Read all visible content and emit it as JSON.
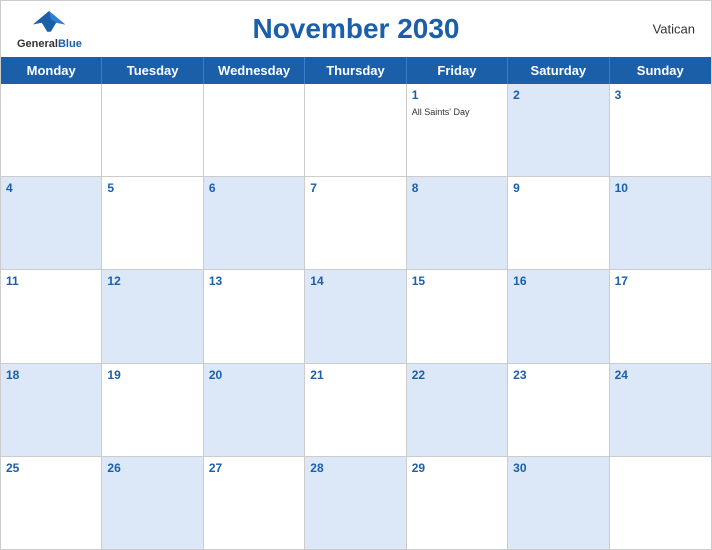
{
  "header": {
    "title": "November 2030",
    "country": "Vatican",
    "logo": {
      "general": "General",
      "blue": "Blue"
    }
  },
  "weekdays": [
    {
      "label": "Monday"
    },
    {
      "label": "Tuesday"
    },
    {
      "label": "Wednesday"
    },
    {
      "label": "Thursday"
    },
    {
      "label": "Friday"
    },
    {
      "label": "Saturday"
    },
    {
      "label": "Sunday"
    }
  ],
  "weeks": [
    [
      {
        "number": "",
        "shaded": false,
        "empty": true,
        "event": ""
      },
      {
        "number": "",
        "shaded": false,
        "empty": true,
        "event": ""
      },
      {
        "number": "",
        "shaded": false,
        "empty": true,
        "event": ""
      },
      {
        "number": "",
        "shaded": false,
        "empty": true,
        "event": ""
      },
      {
        "number": "1",
        "shaded": false,
        "empty": false,
        "event": "All Saints' Day"
      },
      {
        "number": "2",
        "shaded": true,
        "empty": false,
        "event": ""
      },
      {
        "number": "3",
        "shaded": false,
        "empty": false,
        "event": ""
      }
    ],
    [
      {
        "number": "4",
        "shaded": true,
        "empty": false,
        "event": ""
      },
      {
        "number": "5",
        "shaded": false,
        "empty": false,
        "event": ""
      },
      {
        "number": "6",
        "shaded": true,
        "empty": false,
        "event": ""
      },
      {
        "number": "7",
        "shaded": false,
        "empty": false,
        "event": ""
      },
      {
        "number": "8",
        "shaded": true,
        "empty": false,
        "event": ""
      },
      {
        "number": "9",
        "shaded": false,
        "empty": false,
        "event": ""
      },
      {
        "number": "10",
        "shaded": true,
        "empty": false,
        "event": ""
      }
    ],
    [
      {
        "number": "11",
        "shaded": false,
        "empty": false,
        "event": ""
      },
      {
        "number": "12",
        "shaded": true,
        "empty": false,
        "event": ""
      },
      {
        "number": "13",
        "shaded": false,
        "empty": false,
        "event": ""
      },
      {
        "number": "14",
        "shaded": true,
        "empty": false,
        "event": ""
      },
      {
        "number": "15",
        "shaded": false,
        "empty": false,
        "event": ""
      },
      {
        "number": "16",
        "shaded": true,
        "empty": false,
        "event": ""
      },
      {
        "number": "17",
        "shaded": false,
        "empty": false,
        "event": ""
      }
    ],
    [
      {
        "number": "18",
        "shaded": true,
        "empty": false,
        "event": ""
      },
      {
        "number": "19",
        "shaded": false,
        "empty": false,
        "event": ""
      },
      {
        "number": "20",
        "shaded": true,
        "empty": false,
        "event": ""
      },
      {
        "number": "21",
        "shaded": false,
        "empty": false,
        "event": ""
      },
      {
        "number": "22",
        "shaded": true,
        "empty": false,
        "event": ""
      },
      {
        "number": "23",
        "shaded": false,
        "empty": false,
        "event": ""
      },
      {
        "number": "24",
        "shaded": true,
        "empty": false,
        "event": ""
      }
    ],
    [
      {
        "number": "25",
        "shaded": false,
        "empty": false,
        "event": ""
      },
      {
        "number": "26",
        "shaded": true,
        "empty": false,
        "event": ""
      },
      {
        "number": "27",
        "shaded": false,
        "empty": false,
        "event": ""
      },
      {
        "number": "28",
        "shaded": true,
        "empty": false,
        "event": ""
      },
      {
        "number": "29",
        "shaded": false,
        "empty": false,
        "event": ""
      },
      {
        "number": "30",
        "shaded": true,
        "empty": false,
        "event": ""
      },
      {
        "number": "",
        "shaded": false,
        "empty": true,
        "event": ""
      }
    ]
  ],
  "colors": {
    "primary": "#1a5fa8",
    "shaded": "#dce8f7",
    "white": "#ffffff"
  }
}
